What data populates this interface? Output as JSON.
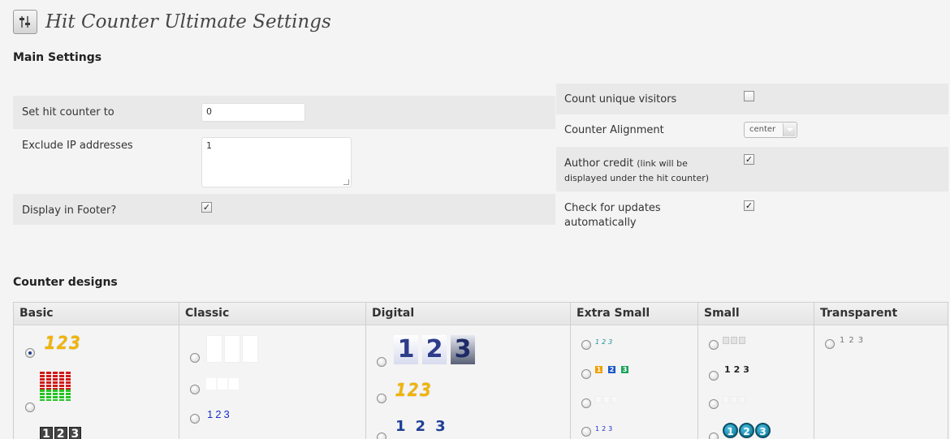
{
  "page": {
    "title": "Hit Counter Ultimate Settings"
  },
  "main_settings": {
    "heading": "Main Settings",
    "set_hit_counter_label": "Set hit counter to",
    "set_hit_counter_value": "0",
    "exclude_ip_label": "Exclude IP addresses",
    "exclude_ip_value": "1",
    "display_footer_label": "Display in Footer?",
    "display_footer_checked": true,
    "count_unique_label": "Count unique visitors",
    "count_unique_checked": false,
    "alignment_label": "Counter Alignment",
    "alignment_value": "center",
    "author_credit_label": "Author credit",
    "author_credit_note": "(link will be displayed under the hit counter)",
    "author_credit_checked": true,
    "check_updates_label": "Check for updates automatically",
    "check_updates_checked": true
  },
  "designs": {
    "heading": "Counter designs",
    "columns": [
      {
        "title": "Basic"
      },
      {
        "title": "Classic"
      },
      {
        "title": "Digital"
      },
      {
        "title": "Extra Small"
      },
      {
        "title": "Small"
      },
      {
        "title": "Transparent"
      }
    ],
    "samples": {
      "digits": "123",
      "d1": "1",
      "d2": "2",
      "d3": "3"
    },
    "selected": "Basic 1"
  },
  "colors": {
    "shade": "#e9e9e9",
    "accent": "#1f3f86"
  }
}
